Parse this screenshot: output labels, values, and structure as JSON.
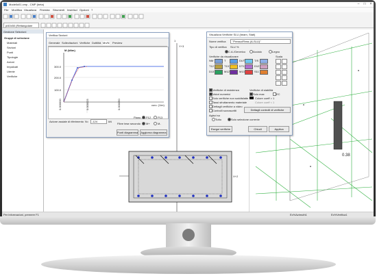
{
  "window": {
    "title": "Modello01.cmp - CMP (beta)"
  },
  "menu": [
    "File",
    "Modifica",
    "Visualizza",
    "Finestra",
    "Strumenti",
    "Inserisci",
    "Opzioni",
    "?"
  ],
  "toolbar": {
    "combo_value": "pl40x50 (Rettangolare"
  },
  "tree": {
    "header": "Gestione Selezioni",
    "root": "Gruppi di selezione",
    "items": [
      "Materiali",
      "Sezioni",
      "Punti",
      "Tipologie",
      "Azioni",
      "Impalcati",
      "Utente",
      "Verifiche"
    ]
  },
  "left_dialog": {
    "title": "Verifica Sezioni",
    "tabs": [
      "Generale",
      "Sollecitazioni",
      "Verifiche",
      "Duttilità",
      "Mn/N",
      "Preview"
    ],
    "chart_ylabel": "M (kNm)",
    "chart_xlabel": "curv. (1/m)",
    "y_ticks": [
      "300.0",
      "200.0",
      "100.0"
    ],
    "x_ticks": [
      "0.000000",
      "0.000025",
      "0.000050"
    ],
    "axial_label": "Azione assiale di riferimento",
    "axial_var": "N=",
    "axial_value": "-124",
    "axial_unit": "kN",
    "plane_label": "Piano",
    "plane_options": [
      "P12",
      "P13"
    ],
    "dir_label": "Fibre tese secondo",
    "dir_options": [
      "M+",
      "M-"
    ],
    "btn_points": "Punti diagramma",
    "btn_update": "Aggiorna diagramma"
  },
  "center_view": {
    "axis_y": "Y+3",
    "axis_x": "X+2",
    "marker": "1"
  },
  "right_dialog": {
    "title": "Visualizza Verifiche SLU (beam, Stati)",
    "name_label": "Nome verifica",
    "name_value": "\"Presso/Fless (A-SLU)\"",
    "type_label": "Tipo di verifica",
    "type_value": "SLU %",
    "mode_options": [
      "C.A./Generico",
      "Acciaio",
      "Legno"
    ],
    "section_label": "Verifiche da visualizzare",
    "scale_label": "Scala",
    "swatches": [
      {
        "label": "NM",
        "name": "NM",
        "color": "#7aa0d8"
      },
      {
        "label": "T",
        "name": "T",
        "color": "#5aa0e6"
      },
      {
        "label": "DUT",
        "name": "DUT",
        "color": "#70c8f0"
      },
      {
        "label": "T/S",
        "name": "T/S",
        "color": "#8fb0e8"
      },
      {
        "label": "T12",
        "name": "T12",
        "color": "#b8a040"
      },
      {
        "label": "T13",
        "name": "T13",
        "color": "#f0c020"
      },
      {
        "label": "DT1",
        "name": "DT1",
        "color": "#b070d0"
      },
      {
        "label": "D12",
        "name": "D12",
        "color": "#d0a0c0"
      },
      {
        "label": "D13",
        "name": "D13",
        "color": "#2aa060"
      },
      {
        "label": "M12",
        "name": "M12",
        "color": "#7030a0"
      },
      {
        "label": "M13",
        "name": "M13",
        "color": "#e04040"
      },
      {
        "label": "S11",
        "name": "S11",
        "color": "#e08030"
      }
    ],
    "extra_check_labels": [
      "Verifiche di resistenza",
      "Verifiche di stabilità"
    ],
    "show_values": "Valori numerici",
    "sole_verifiche": "Solo verifiche non soddisfatte",
    "tassi": "Tassi sfruttamento materiale",
    "dettagli": "Dettagli verifiche a video",
    "controlli": "Controlli sovrascritti",
    "opt_solo_max": "Solo max",
    "opt_ec": "EC",
    "colore_coeff": "Colore coeff > 1",
    "colore_coeff2": "Colore coeff < 1",
    "btn_dettagli": "Dettagli controlli di verifiche",
    "agisci_label": "Agisci su",
    "agisci_options": [
      "Tutto",
      "Solo selezione corrente"
    ],
    "btn_esegui": "Esegui verifiche",
    "btn_chiudi": "Chiudi",
    "btn_applica": "Applica"
  },
  "right_view": {
    "value_label": "0.38"
  },
  "status": {
    "left": "Per informazioni, premere F1",
    "right1": "Ec%Azimuth1",
    "right2": "Ec%Verifica1"
  }
}
